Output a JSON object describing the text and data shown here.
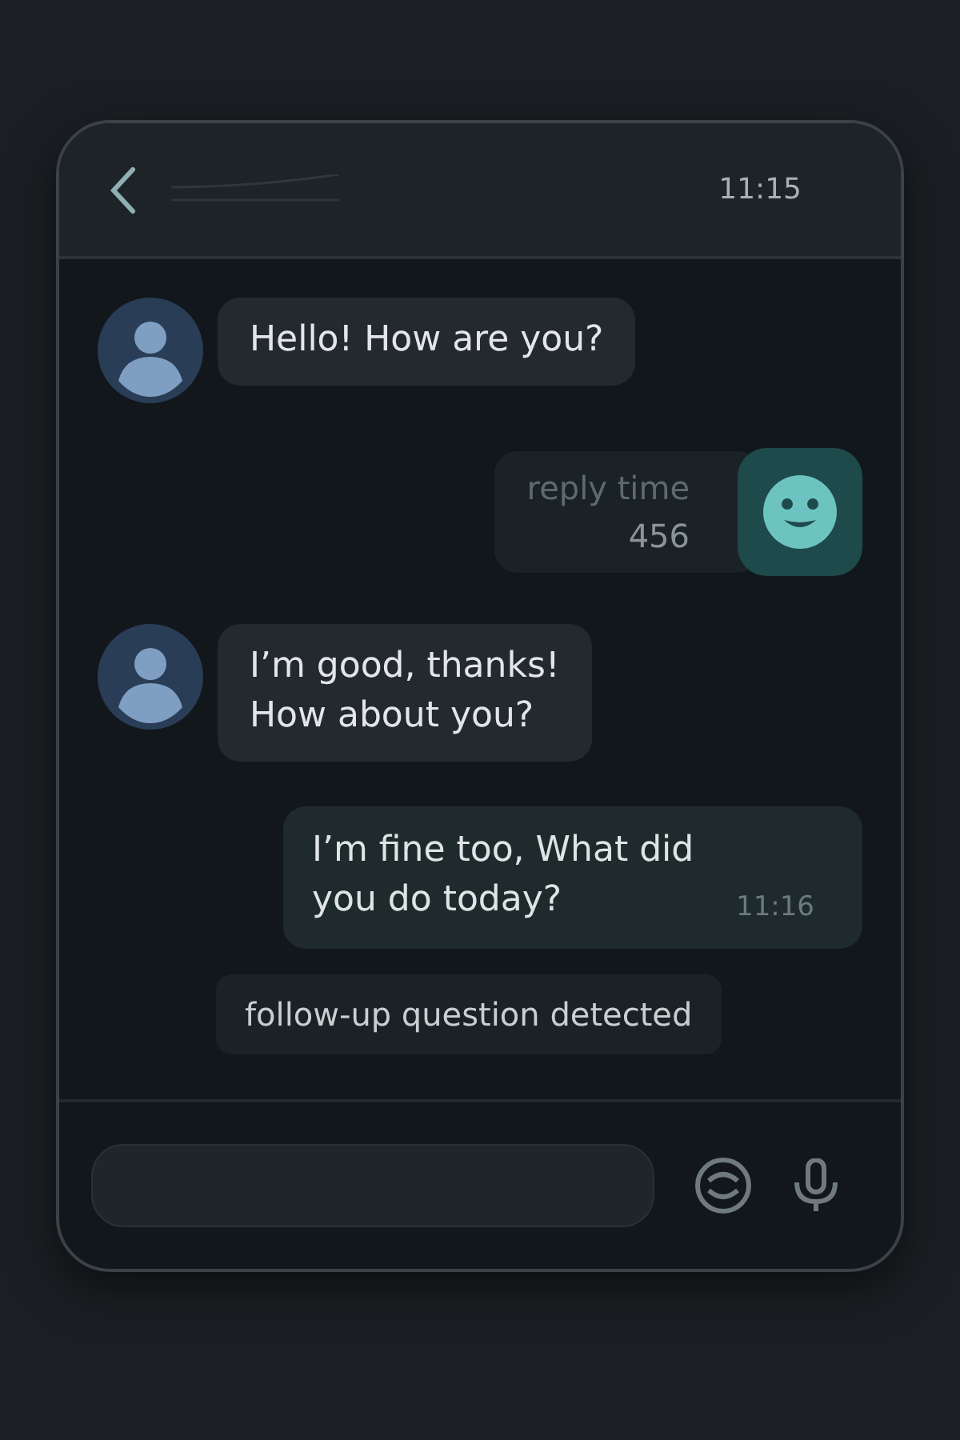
{
  "header": {
    "time": "11:15"
  },
  "messages": [
    {
      "kind": "incoming",
      "text": "Hello! How are you?"
    },
    {
      "kind": "metric",
      "label": "reply time",
      "value": "456"
    },
    {
      "kind": "incoming",
      "text": "I’m good, thanks!\nHow about you?"
    },
    {
      "kind": "outgoing",
      "text": "I’m fine too, What did you do today?",
      "time": "11:16"
    },
    {
      "kind": "note",
      "text": "follow-up question detected"
    }
  ]
}
